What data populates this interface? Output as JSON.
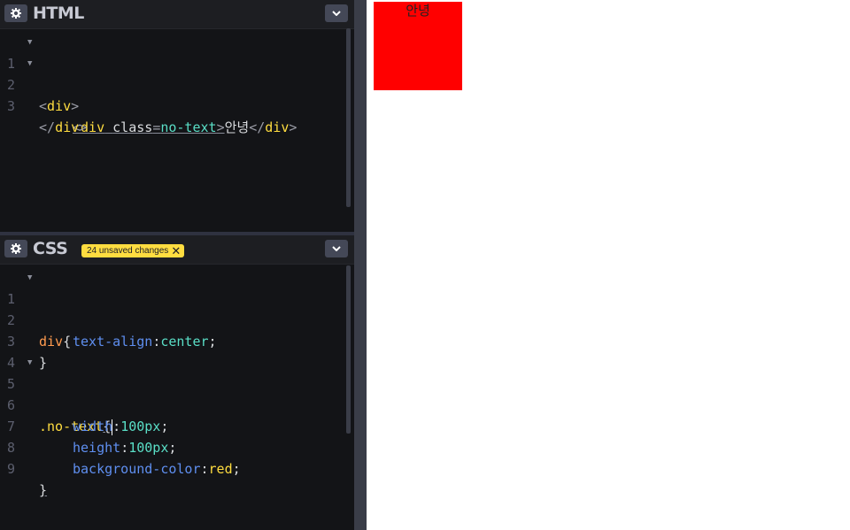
{
  "html_panel": {
    "title": "HTML",
    "lines": [
      {
        "n": "1"
      },
      {
        "n": "2"
      },
      {
        "n": "3"
      }
    ],
    "code": {
      "l1": {
        "open": "<",
        "tag": "div",
        "close": ">"
      },
      "l2": {
        "open": "<",
        "tag": "div",
        "attr": "class",
        "eq": "=",
        "val": "no-text",
        "gt": ">",
        "text": "안녕",
        "endopen": "</",
        "endtag": "div",
        "endclose": ">"
      },
      "l3": {
        "open": "</",
        "tag": "div",
        "close": ">"
      }
    }
  },
  "css_panel": {
    "title": "CSS",
    "badge": "24 unsaved changes",
    "badge_close": "✕",
    "lines": [
      "1",
      "2",
      "3",
      "4",
      "5",
      "6",
      "7",
      "8",
      "9"
    ],
    "code": {
      "sel1": "div",
      "brace_open": "{",
      "p1": "text-align",
      "v1": "center",
      "brace_close": "}",
      "sel2": ".no-text",
      "p2": "width",
      "v2": "100px",
      "p3": "height",
      "v3": "100px",
      "p4": "background-color",
      "v4": "red",
      "colon": ":",
      "semi": ";"
    }
  },
  "preview": {
    "box_text": "안녕",
    "box_color": "#ff0000"
  },
  "colors": {
    "editor_bg": "#131417",
    "accent": "#ffdd40"
  }
}
